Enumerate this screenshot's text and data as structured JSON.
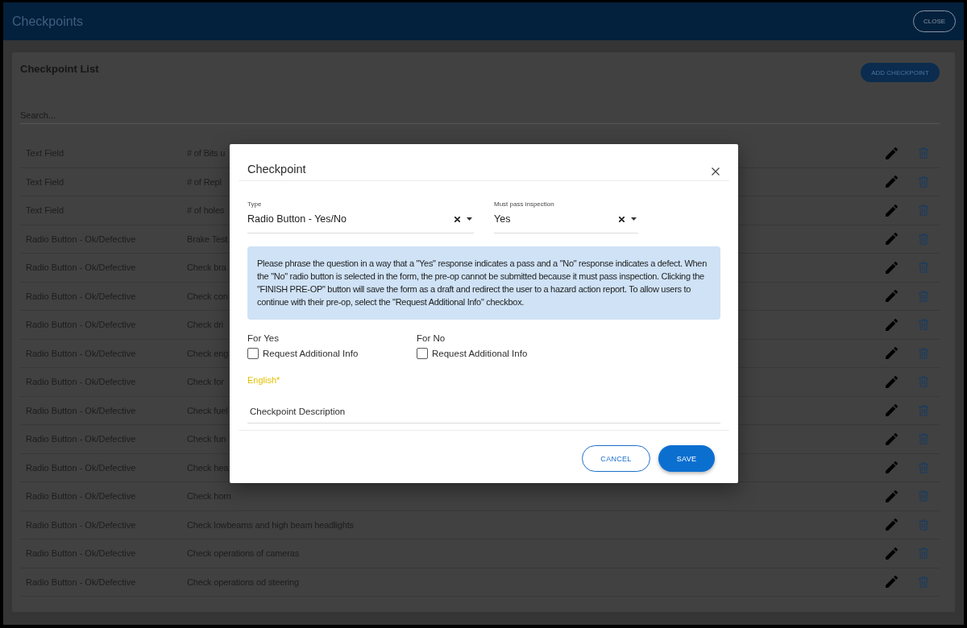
{
  "window": {
    "title": "Checkpoints",
    "close_button": "CLOSE"
  },
  "checkpoint_list": {
    "title": "Checkpoint List",
    "add_button": "ADD CHECKPOINT",
    "search": {
      "placeholder": "Search..."
    },
    "rows": [
      {
        "type": "Text Field",
        "description": "# of Bits u"
      },
      {
        "type": "Text Field",
        "description": "# of Repl"
      },
      {
        "type": "Text Field",
        "description": "# of holes"
      },
      {
        "type": "Radio Button - Ok/Defective",
        "description": "Brake Test"
      },
      {
        "type": "Radio Button - Ok/Defective",
        "description": "Check bra"
      },
      {
        "type": "Radio Button - Ok/Defective",
        "description": "Check con"
      },
      {
        "type": "Radio Button - Ok/Defective",
        "description": "Check dri"
      },
      {
        "type": "Radio Button - Ok/Defective",
        "description": "Check eng"
      },
      {
        "type": "Radio Button - Ok/Defective",
        "description": "Check for"
      },
      {
        "type": "Radio Button - Ok/Defective",
        "description": "Check fuel"
      },
      {
        "type": "Radio Button - Ok/Defective",
        "description": "Check fun"
      },
      {
        "type": "Radio Button - Ok/Defective",
        "description": "Check hea"
      },
      {
        "type": "Radio Button - Ok/Defective",
        "description": "Check horn"
      },
      {
        "type": "Radio Button - Ok/Defective",
        "description": "Check lowbeams and high beam headlights"
      },
      {
        "type": "Radio Button - Ok/Defective",
        "description": "Check operations of cameras"
      },
      {
        "type": "Radio Button - Ok/Defective",
        "description": "Check operations od steering"
      }
    ]
  },
  "dialog": {
    "title": "Checkpoint",
    "fields": [
      {
        "label": "Type",
        "value": "Radio Button - Yes/No"
      },
      {
        "label": "Must pass inspection",
        "value": "Yes"
      }
    ],
    "info": "Please phrase the question in a way that a \"Yes\" response indicates a pass and a \"No\" response indicates a defect. When the \"No\" radio button is selected in the form, the pre-op cannot be submitted because it must pass inspection. Clicking the \"FINISH PRE-OP\" button will save the form as a draft and redirect the user to a hazard action report. To allow users to continue with their pre-op, select the \"Request Additional Info\" checkbox.",
    "options": [
      {
        "heading": "For Yes",
        "checkbox": {
          "label": "Request Additional Info",
          "checked": false
        }
      },
      {
        "heading": "For No",
        "checkbox": {
          "label": "Request Additional Info",
          "checked": false
        }
      }
    ],
    "language": {
      "label": "English*"
    },
    "description": {
      "placeholder": "Checkpoint Description"
    },
    "buttons": [
      {
        "label": "CANCEL",
        "kind": "outlined"
      },
      {
        "label": "SAVE",
        "kind": "filled"
      }
    ]
  }
}
